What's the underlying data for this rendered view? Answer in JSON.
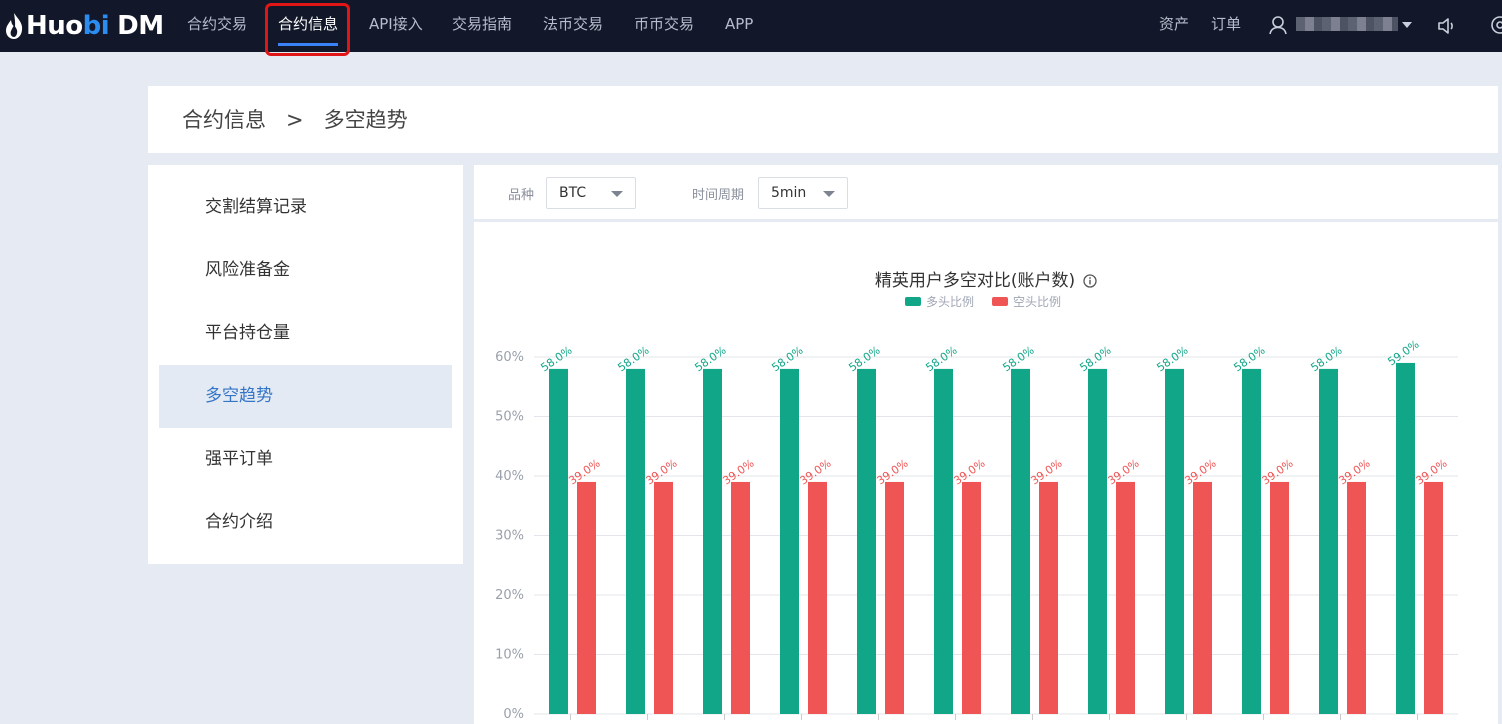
{
  "brand": {
    "name_huo": "Huo",
    "name_bi": "bi",
    "name_dm": "DM"
  },
  "nav": {
    "items": [
      "合约交易",
      "合约信息",
      "API接入",
      "交易指南",
      "法币交易",
      "币币交易",
      "APP"
    ],
    "active": "合约信息",
    "assets": "资产",
    "orders": "订单"
  },
  "breadcrumb": {
    "parent": "合约信息",
    "separator": ">",
    "current": "多空趋势"
  },
  "sidebar": {
    "items": [
      "交割结算记录",
      "风险准备金",
      "平台持仓量",
      "多空趋势",
      "强平订单",
      "合约介绍"
    ],
    "active": "多空趋势"
  },
  "filters": {
    "symbol_label": "品种",
    "symbol_value": "BTC",
    "period_label": "时间周期",
    "period_value": "5min"
  },
  "colors": {
    "long": "#12a688",
    "short": "#ef5555",
    "nav_bg": "#121829",
    "accent": "#3b82f6"
  },
  "chart_data": {
    "type": "bar",
    "title": "精英用户多空对比(账户数)",
    "legend_position": "top-center",
    "grid": true,
    "ylim": [
      0,
      60
    ],
    "yticks": [
      "0%",
      "10%",
      "20%",
      "30%",
      "40%",
      "50%",
      "60%"
    ],
    "unit": "%",
    "series": [
      {
        "name": "多头比例",
        "color": "#12a688",
        "values": [
          58.0,
          58.0,
          58.0,
          58.0,
          58.0,
          58.0,
          58.0,
          58.0,
          58.0,
          58.0,
          58.0,
          59.0
        ]
      },
      {
        "name": "空头比例",
        "color": "#ef5555",
        "values": [
          39.0,
          39.0,
          39.0,
          39.0,
          39.0,
          39.0,
          39.0,
          39.0,
          39.0,
          39.0,
          39.0,
          39.0
        ]
      }
    ]
  }
}
